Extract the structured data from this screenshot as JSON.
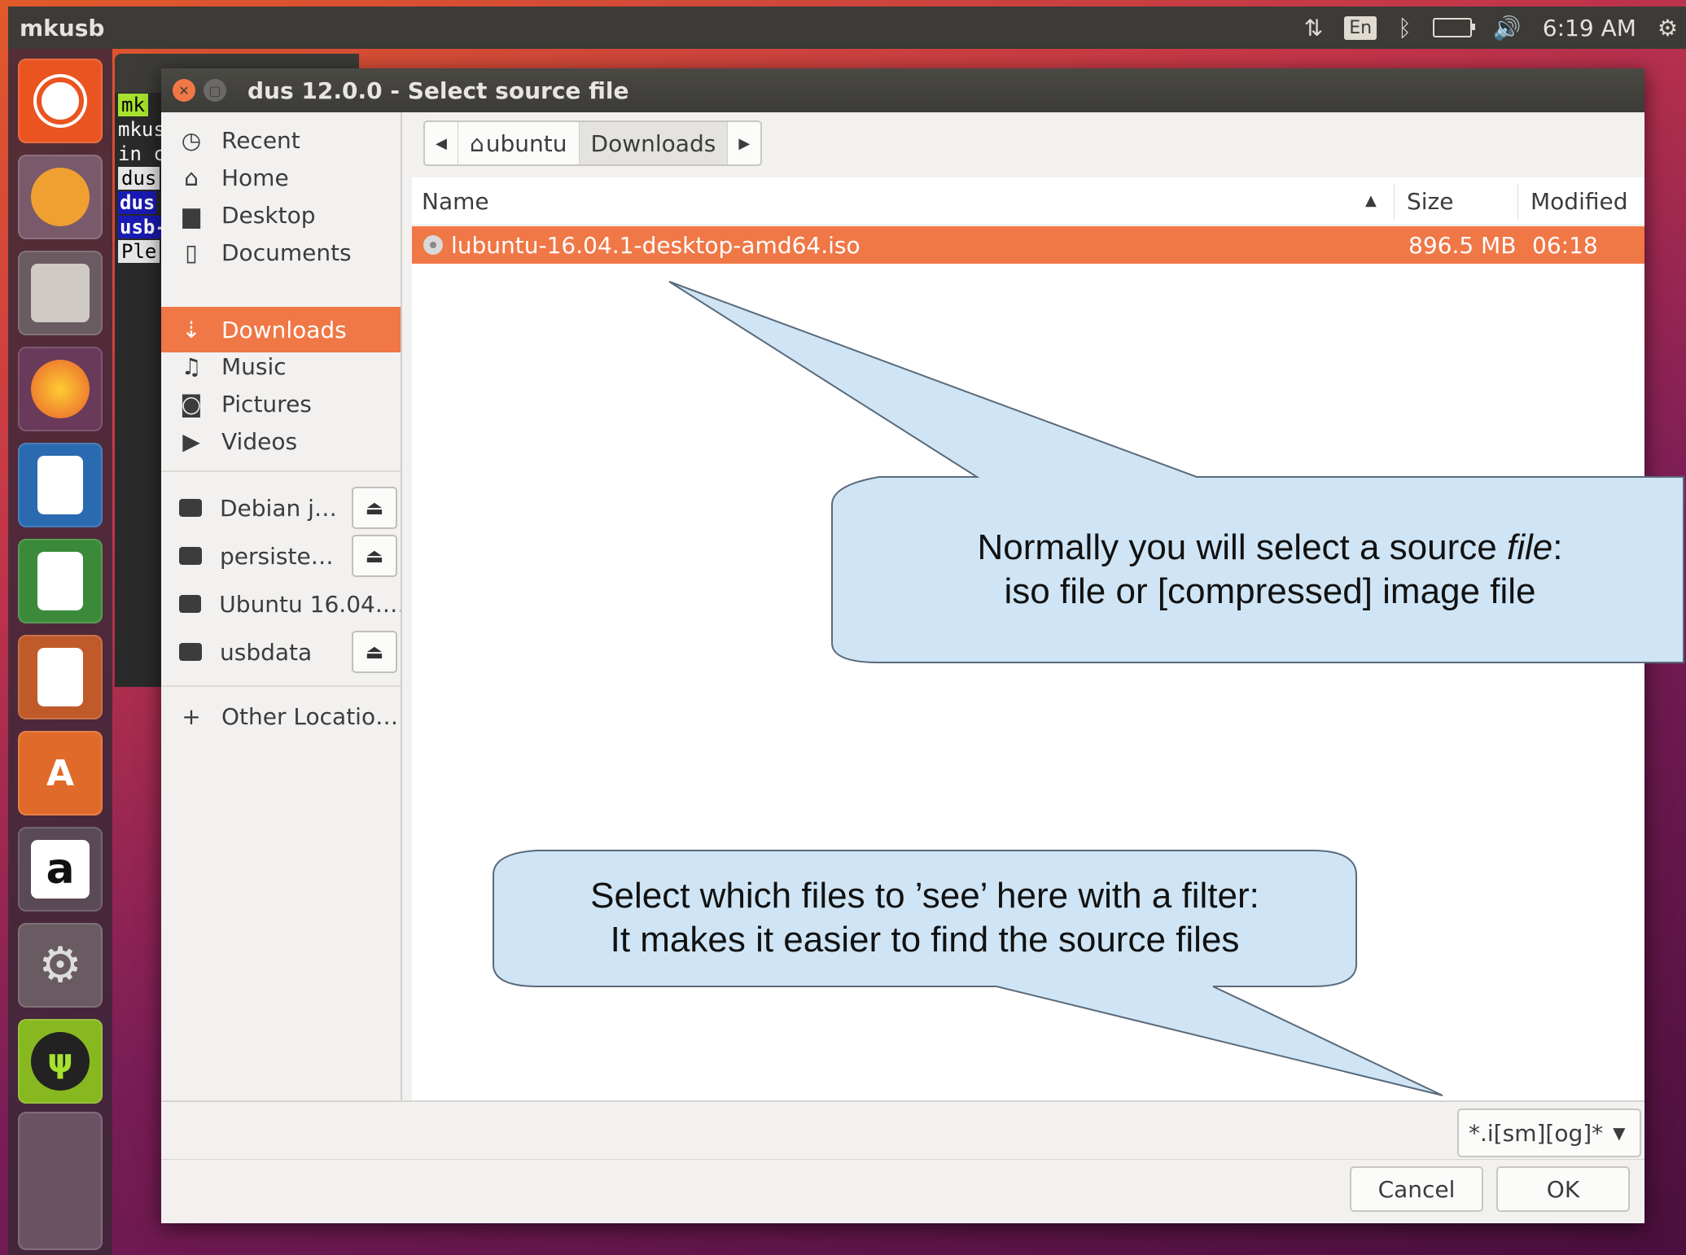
{
  "panel": {
    "app_name": "mkusb",
    "keyboard_indicator": "En",
    "clock": "6:19 AM"
  },
  "terminal": {
    "lines": [
      "mk",
      "mkus",
      "in c",
      "dus",
      "dus",
      "usb-",
      "Ple"
    ]
  },
  "dialog": {
    "title": "dus 12.0.0 - Select source file",
    "sidebar": {
      "places": [
        {
          "label": "Recent",
          "icon": "clock-icon"
        },
        {
          "label": "Home",
          "icon": "home-icon"
        },
        {
          "label": "Desktop",
          "icon": "folder-icon"
        },
        {
          "label": "Documents",
          "icon": "document-icon"
        },
        {
          "label": "Downloads",
          "icon": "download-icon"
        },
        {
          "label": "Music",
          "icon": "music-icon"
        },
        {
          "label": "Pictures",
          "icon": "camera-icon"
        },
        {
          "label": "Videos",
          "icon": "video-icon"
        }
      ],
      "devices": [
        {
          "label": "Debian j…",
          "ejectable": true
        },
        {
          "label": "persiste…",
          "ejectable": true
        },
        {
          "label": "Ubuntu 16.04.…",
          "ejectable": false
        },
        {
          "label": "usbdata",
          "ejectable": true
        }
      ],
      "other_locations": "Other Locatio…"
    },
    "pathbar": {
      "home": "ubuntu",
      "current": "Downloads"
    },
    "columns": {
      "name": "Name",
      "size": "Size",
      "modified": "Modified"
    },
    "files": [
      {
        "name": "lubuntu-16.04.1-desktop-amd64.iso",
        "size": "896.5 MB",
        "modified": "06:18",
        "selected": true
      }
    ],
    "filter": {
      "value": "*.i[sm][og]*"
    },
    "buttons": {
      "cancel": "Cancel",
      "ok": "OK"
    }
  },
  "callouts": {
    "top_line1_a": "Normally you will select a source ",
    "top_line1_em": "file",
    "top_line1_b": ":",
    "top_line2": "iso file or [compressed] image file",
    "bottom_line1": "Select which files to ’see’ here with a filter:",
    "bottom_line2": "It makes it easier to find the source files"
  },
  "colors": {
    "accent": "#f07746",
    "panel": "#3c3b37",
    "callout_fill": "#cfe5f5"
  }
}
